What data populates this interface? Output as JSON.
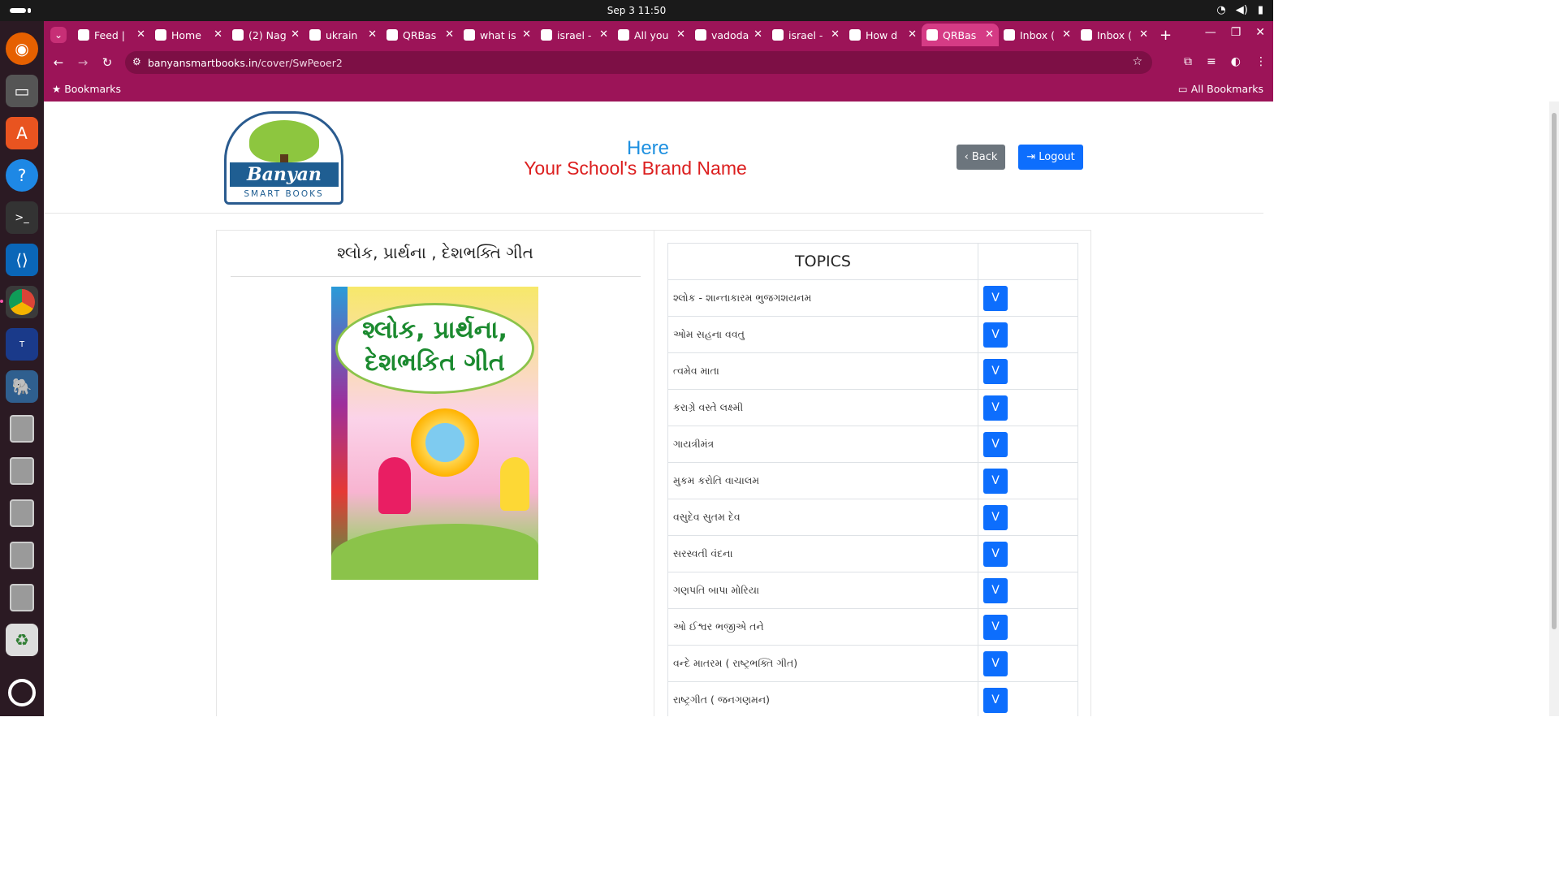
{
  "system": {
    "clock": "Sep 3  11:50"
  },
  "browser": {
    "tabs": [
      {
        "title": "Feed |",
        "favicon": "in",
        "active": false
      },
      {
        "title": "Home",
        "favicon": "H",
        "active": false
      },
      {
        "title": "(2) Nag",
        "favicon": "▶",
        "active": false
      },
      {
        "title": "ukrain",
        "favicon": "G",
        "active": false
      },
      {
        "title": "QRBas",
        "favicon": "Q",
        "active": false
      },
      {
        "title": "what is",
        "favicon": "G",
        "active": false
      },
      {
        "title": "israel -",
        "favicon": "G",
        "active": false
      },
      {
        "title": "All you",
        "favicon": "H",
        "active": false
      },
      {
        "title": "vadoda",
        "favicon": "G",
        "active": false
      },
      {
        "title": "israel -",
        "favicon": "G",
        "active": false
      },
      {
        "title": "How d",
        "favicon": "●",
        "active": false
      },
      {
        "title": "QRBas",
        "favicon": "●",
        "active": true
      },
      {
        "title": "Inbox (",
        "favicon": "M",
        "active": false
      },
      {
        "title": "Inbox (",
        "favicon": "M",
        "active": false
      }
    ],
    "url_host": "banyansmartbooks.in",
    "url_path": "/cover/SwPeoer2",
    "bookmarks_label": "Bookmarks",
    "all_bookmarks_label": "All Bookmarks",
    "theme_color": "#9c1458"
  },
  "header": {
    "logo_text": "Banyan",
    "logo_sub": "SMART BOOKS",
    "brand_line1": "Here",
    "brand_line2": "Your School's Brand Name",
    "back_label": "Back",
    "logout_label": "Logout"
  },
  "book": {
    "title": "શ્લોક, પ્રાર્થના , દેશભક્તિ ગીત",
    "cover_line1": "શ્લોક, પ્રાર્થના,",
    "cover_line2": "દેશભકિત ગીત"
  },
  "topics": {
    "header": "TOPICS",
    "view_label": "V",
    "items": [
      "શ્લોક - શાન્તાકારમ ભુજગશયનમ",
      "ઓમ સહના વવતુ",
      "ત્વમેવ માતા",
      "કરાગ્રે વસ્તે લક્ષ્મી",
      "ગાયત્રીમંત્ર",
      "મુકમ કરોતિ વાચાલમ",
      "વસુદેવ સુતમ દેવ",
      "સરસ્વતી વંદના",
      "ગણપતિ બાપા મોરિયા",
      "ઓ ઈશ્વર ભજીએ તને",
      "વન્દે માતરમ ( રાષ્ટ્રભક્તિ ગીત)",
      "રાષ્ટ્રગીત ( જનગણમન)"
    ]
  }
}
